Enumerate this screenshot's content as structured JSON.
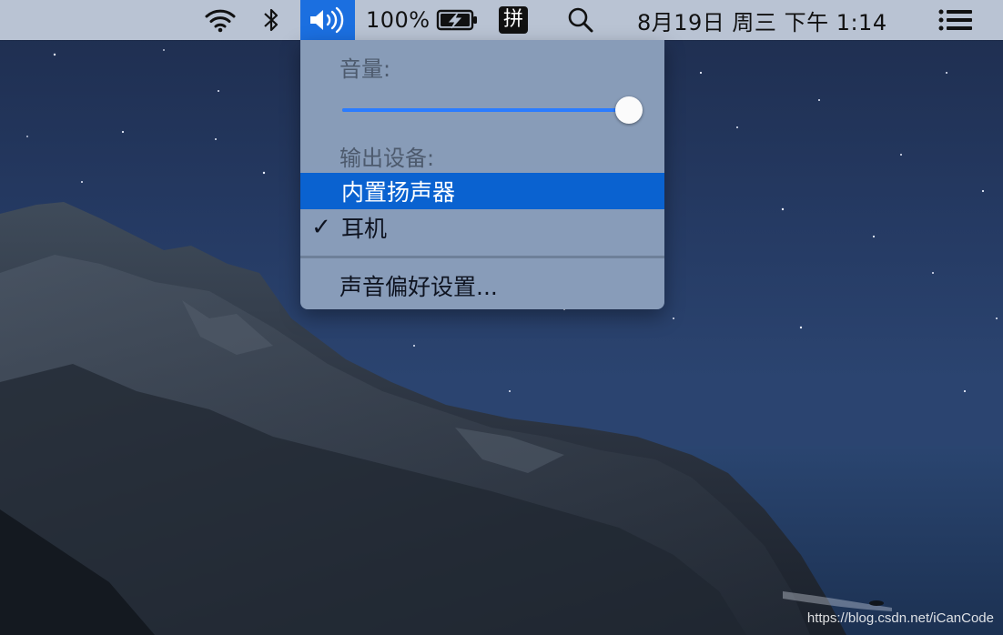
{
  "menubar": {
    "icons": {
      "wifi": "wifi-icon",
      "bluetooth": "bluetooth-icon",
      "volume": "volume-icon",
      "battery": "battery-charging-icon",
      "search": "spotlight-search-icon",
      "notification": "notification-center-icon"
    },
    "battery_percent": "100%",
    "input_method": "拼",
    "datetime": "8月19日 周三 下午 1:14",
    "colors": {
      "bar_bg": "#b9c3d3",
      "volume_active_bg": "#1b6fe0"
    }
  },
  "sound_menu": {
    "volume_label": "音量:",
    "volume_level_percent": 96,
    "output_devices_label": "输出设备:",
    "devices": [
      {
        "label": "内置扬声器",
        "checked": false,
        "highlighted": true
      },
      {
        "label": "耳机",
        "checked": true,
        "highlighted": false
      }
    ],
    "checkmark": "✓",
    "preferences_label": "声音偏好设置...",
    "colors": {
      "menu_bg": "#8ca0bc",
      "highlight": "#0a62d0",
      "slider_fill": "#2b7cff"
    }
  },
  "watermark": "https://blog.csdn.net/iCanCode"
}
